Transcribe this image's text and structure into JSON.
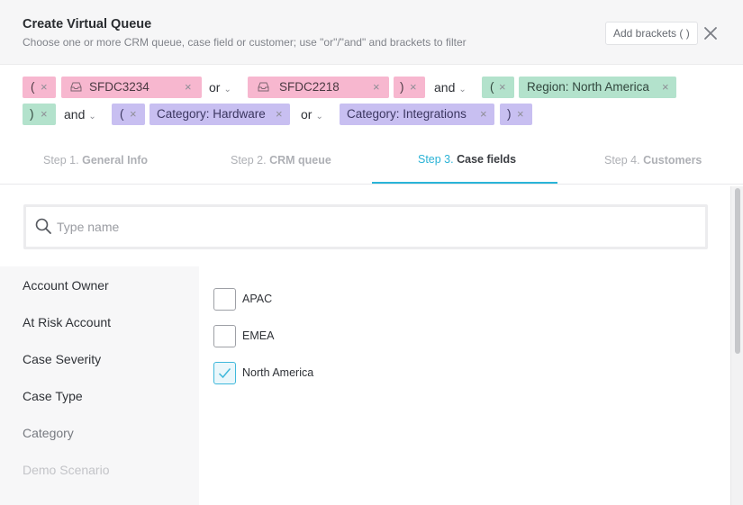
{
  "dialog": {
    "title": "Create Virtual Queue",
    "subtitle": "Choose one or more CRM queue, case field or customer; use \"or\"/\"and\" and brackets to filter",
    "add_brackets_label": "Add brackets ( )",
    "close_icon": "close-icon"
  },
  "expression": {
    "open_bracket": "(",
    "close_bracket": ")",
    "remove_glyph": "×",
    "chevron_glyph": "⌄",
    "queue_1": "SFDC3234",
    "queue_2": "SFDC2218",
    "op_or_1": "or",
    "op_and_1": "and",
    "region_key": "Region: ",
    "region_value": "North America",
    "op_and_2": "and",
    "category_key_1": "Category: ",
    "category_value_1": "Hardware",
    "op_or_2": "or",
    "category_key_2": "Category: ",
    "category_value_2": "Integrations",
    "colors": {
      "queue_chip": "#f7b7cf",
      "field_chip": "#b3e2cc",
      "category_chip": "#c8bff1"
    }
  },
  "steps": [
    {
      "prefix": "Step 1. ",
      "label": "General Info"
    },
    {
      "prefix": "Step 2. ",
      "label": "CRM queue"
    },
    {
      "prefix": "Step 3. ",
      "label": "Case fields"
    },
    {
      "prefix": "Step 4. ",
      "label": "Customers"
    }
  ],
  "active_step_color": "#2ab4d8",
  "search": {
    "placeholder": "Type name",
    "value": ""
  },
  "case_fields": [
    "Account Owner",
    "At Risk Account",
    "Case Severity",
    "Case Type",
    "Category",
    "Demo Scenario"
  ],
  "options": [
    {
      "label": "APAC",
      "checked": false
    },
    {
      "label": "EMEA",
      "checked": false
    },
    {
      "label": "North America",
      "checked": true
    }
  ]
}
